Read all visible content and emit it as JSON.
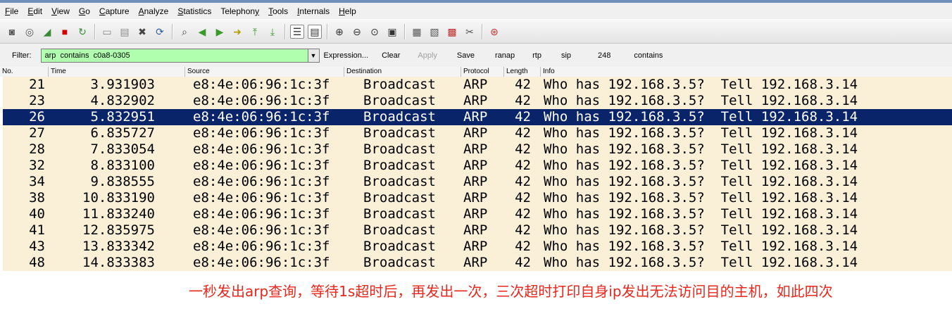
{
  "menu": [
    {
      "label": "File",
      "key": "F"
    },
    {
      "label": "Edit",
      "key": "E"
    },
    {
      "label": "View",
      "key": "V"
    },
    {
      "label": "Go",
      "key": "G"
    },
    {
      "label": "Capture",
      "key": "C"
    },
    {
      "label": "Analyze",
      "key": "A"
    },
    {
      "label": "Statistics",
      "key": "S"
    },
    {
      "label": "Telephony",
      "key": "y"
    },
    {
      "label": "Tools",
      "key": "T"
    },
    {
      "label": "Internals",
      "key": "I"
    },
    {
      "label": "Help",
      "key": "H"
    }
  ],
  "toolbar": {
    "icons": [
      "interfaces-icon",
      "options-icon",
      "start-capture-icon",
      "stop-capture-icon",
      "restart-capture-icon",
      "|",
      "open-file-icon",
      "save-file-icon",
      "close-file-icon",
      "reload-icon",
      "|",
      "find-icon",
      "go-back-icon",
      "go-forward-icon",
      "go-to-packet-icon",
      "go-first-icon",
      "go-last-icon",
      "|",
      "colorize-icon",
      "auto-scroll-icon",
      "|",
      "zoom-in-icon",
      "zoom-out-icon",
      "zoom-normal-icon",
      "resize-columns-icon",
      "|",
      "capture-filters-icon",
      "display-filters-icon",
      "coloring-rules-icon",
      "preferences-icon",
      "|",
      "help-icon"
    ],
    "pressed": [
      "colorize-icon",
      "auto-scroll-icon"
    ]
  },
  "filter": {
    "label": "Filter:",
    "value": "arp  contains  c0a8-0305",
    "links": [
      {
        "label": "Expression...",
        "enabled": true
      },
      {
        "label": "Clear",
        "enabled": true
      },
      {
        "label": "Apply",
        "enabled": false
      },
      {
        "label": "Save",
        "enabled": true
      },
      {
        "label": "ranap",
        "enabled": true
      },
      {
        "label": "rtp",
        "enabled": true
      },
      {
        "label": "sip",
        "enabled": true
      },
      {
        "label": "248",
        "enabled": true
      },
      {
        "label": "contains",
        "enabled": true
      }
    ]
  },
  "columns": {
    "no": "No.",
    "time": "Time",
    "source": "Source",
    "destination": "Destination",
    "protocol": "Protocol",
    "length": "Length",
    "info": "Info"
  },
  "selected_packet": "26",
  "packets": [
    {
      "no": "21",
      "time": "3.931903",
      "source": "e8:4e:06:96:1c:3f",
      "destination": "Broadcast",
      "protocol": "ARP",
      "length": "42",
      "info": "Who has 192.168.3.5?  Tell 192.168.3.14"
    },
    {
      "no": "23",
      "time": "4.832902",
      "source": "e8:4e:06:96:1c:3f",
      "destination": "Broadcast",
      "protocol": "ARP",
      "length": "42",
      "info": "Who has 192.168.3.5?  Tell 192.168.3.14"
    },
    {
      "no": "26",
      "time": "5.832951",
      "source": "e8:4e:06:96:1c:3f",
      "destination": "Broadcast",
      "protocol": "ARP",
      "length": "42",
      "info": "Who has 192.168.3.5?  Tell 192.168.3.14"
    },
    {
      "no": "27",
      "time": "6.835727",
      "source": "e8:4e:06:96:1c:3f",
      "destination": "Broadcast",
      "protocol": "ARP",
      "length": "42",
      "info": "Who has 192.168.3.5?  Tell 192.168.3.14"
    },
    {
      "no": "28",
      "time": "7.833054",
      "source": "e8:4e:06:96:1c:3f",
      "destination": "Broadcast",
      "protocol": "ARP",
      "length": "42",
      "info": "Who has 192.168.3.5?  Tell 192.168.3.14"
    },
    {
      "no": "32",
      "time": "8.833100",
      "source": "e8:4e:06:96:1c:3f",
      "destination": "Broadcast",
      "protocol": "ARP",
      "length": "42",
      "info": "Who has 192.168.3.5?  Tell 192.168.3.14"
    },
    {
      "no": "34",
      "time": "9.838555",
      "source": "e8:4e:06:96:1c:3f",
      "destination": "Broadcast",
      "protocol": "ARP",
      "length": "42",
      "info": "Who has 192.168.3.5?  Tell 192.168.3.14"
    },
    {
      "no": "38",
      "time": "10.833190",
      "source": "e8:4e:06:96:1c:3f",
      "destination": "Broadcast",
      "protocol": "ARP",
      "length": "42",
      "info": "Who has 192.168.3.5?  Tell 192.168.3.14"
    },
    {
      "no": "40",
      "time": "11.833240",
      "source": "e8:4e:06:96:1c:3f",
      "destination": "Broadcast",
      "protocol": "ARP",
      "length": "42",
      "info": "Who has 192.168.3.5?  Tell 192.168.3.14"
    },
    {
      "no": "41",
      "time": "12.835975",
      "source": "e8:4e:06:96:1c:3f",
      "destination": "Broadcast",
      "protocol": "ARP",
      "length": "42",
      "info": "Who has 192.168.3.5?  Tell 192.168.3.14"
    },
    {
      "no": "43",
      "time": "13.833342",
      "source": "e8:4e:06:96:1c:3f",
      "destination": "Broadcast",
      "protocol": "ARP",
      "length": "42",
      "info": "Who has 192.168.3.5?  Tell 192.168.3.14"
    },
    {
      "no": "48",
      "time": "14.833383",
      "source": "e8:4e:06:96:1c:3f",
      "destination": "Broadcast",
      "protocol": "ARP",
      "length": "42",
      "info": "Who has 192.168.3.5?  Tell 192.168.3.14"
    }
  ],
  "annotation": "一秒发出arp查询，等待1s超时后，再发出一次，三次超时打印自身ip发出无法访问目的主机，如此四次",
  "colors": {
    "row_background": "#faf0d7",
    "selected_row_background": "#0a246a",
    "filter_valid_background": "#afffaf",
    "annotation_text": "#e8261b"
  }
}
